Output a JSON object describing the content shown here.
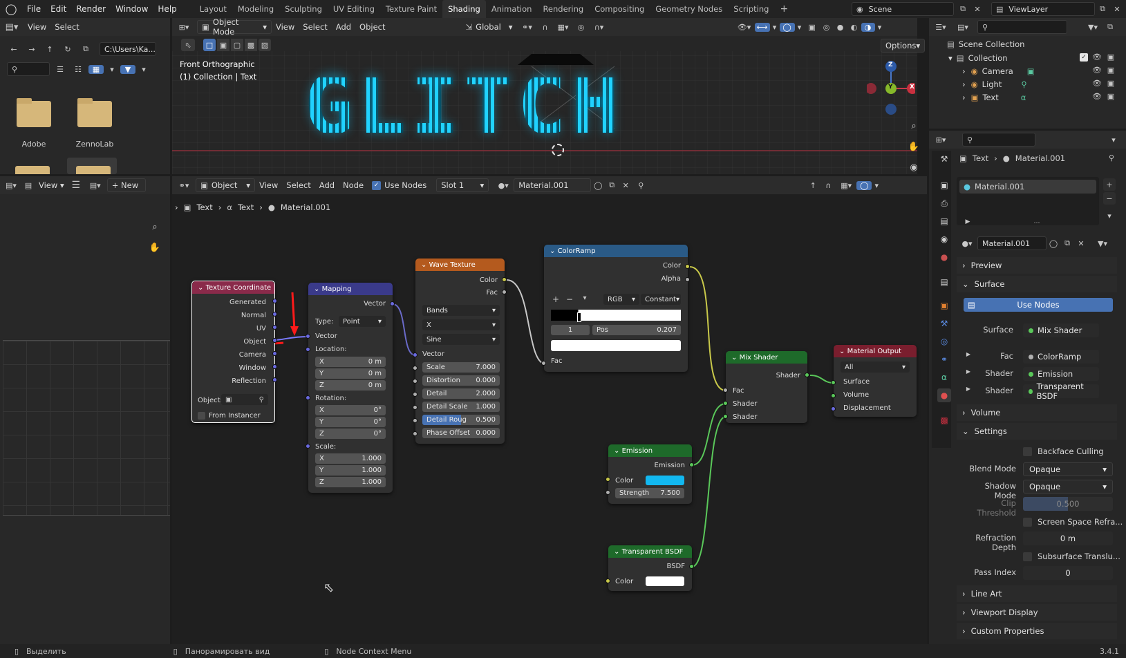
{
  "topbar": {
    "menus": [
      "File",
      "Edit",
      "Render",
      "Window",
      "Help"
    ],
    "workspaces": [
      "Layout",
      "Modeling",
      "Sculpting",
      "UV Editing",
      "Texture Paint",
      "Shading",
      "Animation",
      "Rendering",
      "Compositing",
      "Geometry Nodes",
      "Scripting"
    ],
    "active_workspace": "Shading",
    "add_tab": "+",
    "scene": "Scene",
    "view_layer": "ViewLayer"
  },
  "filebrowser": {
    "view": "View",
    "select": "Select",
    "path": "C:\\Users\\Ka...",
    "folders": [
      "Adobe",
      "ZennoLab"
    ]
  },
  "viewport": {
    "mode": "Object Mode",
    "view": "View",
    "select": "Select",
    "add": "Add",
    "object": "Object",
    "transform": "Global",
    "options": "Options",
    "info_line1": "Front Orthographic",
    "info_line2": "(1) Collection | Text",
    "neon_text": "GLITCH",
    "gizmo": {
      "z": "Z",
      "y": "Y",
      "x": "X"
    }
  },
  "image_editor": {
    "view": "View",
    "new": "New"
  },
  "node_editor": {
    "editor_type": "Object",
    "view": "View",
    "select": "Select",
    "add": "Add",
    "node": "Node",
    "use_nodes": "Use Nodes",
    "slot": "Slot 1",
    "material": "Material.001",
    "breadcrumb": [
      "Text",
      "Text",
      "Material.001"
    ]
  },
  "nodes": {
    "texcoord": {
      "title": "Texture Coordinate",
      "outputs": [
        "Generated",
        "Normal",
        "UV",
        "Object",
        "Camera",
        "Window",
        "Reflection"
      ],
      "object_label": "Object:",
      "from_instancer": "From Instancer"
    },
    "mapping": {
      "title": "Mapping",
      "vector_out": "Vector",
      "type_label": "Type:",
      "type_value": "Point",
      "vector_in": "Vector",
      "location": "Location:",
      "loc": [
        [
          "X",
          "0 m"
        ],
        [
          "Y",
          "0 m"
        ],
        [
          "Z",
          "0 m"
        ]
      ],
      "rotation": "Rotation:",
      "rot": [
        [
          "X",
          "0°"
        ],
        [
          "Y",
          "0°"
        ],
        [
          "Z",
          "0°"
        ]
      ],
      "scale": "Scale:",
      "scl": [
        [
          "X",
          "1.000"
        ],
        [
          "Y",
          "1.000"
        ],
        [
          "Z",
          "1.000"
        ]
      ]
    },
    "wave": {
      "title": "Wave Texture",
      "out_color": "Color",
      "out_fac": "Fac",
      "type": "Bands",
      "direction": "X",
      "profile": "Sine",
      "vector_in": "Vector",
      "fields": [
        [
          "Scale",
          "7.000"
        ],
        [
          "Distortion",
          "0.000"
        ],
        [
          "Detail",
          "2.000"
        ],
        [
          "Detail Scale",
          "1.000"
        ],
        [
          "Detail Roug",
          "0.500"
        ],
        [
          "Phase Offset",
          "0.000"
        ]
      ]
    },
    "colorramp": {
      "title": "ColorRamp",
      "out_color": "Color",
      "out_alpha": "Alpha",
      "mode": "RGB",
      "interp": "Constant",
      "index": "1",
      "pos_label": "Pos",
      "pos_value": "0.207",
      "fac_in": "Fac"
    },
    "mixshader": {
      "title": "Mix Shader",
      "out": "Shader",
      "inputs": [
        "Fac",
        "Shader",
        "Shader"
      ]
    },
    "matoutput": {
      "title": "Material Output",
      "target": "All",
      "inputs": [
        "Surface",
        "Volume",
        "Displacement"
      ]
    },
    "emission": {
      "title": "Emission",
      "out": "Emission",
      "color": "Color",
      "strength_label": "Strength",
      "strength_value": "7.500",
      "color_hex": "#12b8f0"
    },
    "transparent": {
      "title": "Transparent BSDF",
      "out": "BSDF",
      "color": "Color"
    }
  },
  "outliner": {
    "root": "Scene Collection",
    "collection": "Collection",
    "items": [
      "Camera",
      "Light",
      "Text"
    ]
  },
  "properties": {
    "breadcrumb_object": "Text",
    "breadcrumb_material": "Material.001",
    "slot_material": "Material.001",
    "datablock": "Material.001",
    "panels": {
      "preview": "Preview",
      "surface": "Surface",
      "volume": "Volume",
      "settings": "Settings",
      "line_art": "Line Art",
      "viewport_display": "Viewport Display",
      "custom_properties": "Custom Properties"
    },
    "use_nodes": "Use Nodes",
    "surface_label": "Surface",
    "surface_value": "Mix Shader",
    "fac_label": "Fac",
    "fac_value": "ColorRamp",
    "shader1_label": "Shader",
    "shader1_value": "Emission",
    "shader2_label": "Shader",
    "shader2_value": "Transparent BSDF",
    "backface_culling": "Backface Culling",
    "blend_mode_label": "Blend Mode",
    "blend_mode": "Opaque",
    "shadow_mode_label": "Shadow Mode",
    "shadow_mode": "Opaque",
    "clip_threshold_label": "Clip Threshold",
    "clip_threshold": "0.500",
    "ssr": "Screen Space Refra...",
    "refraction_depth_label": "Refraction Depth",
    "refraction_depth": "0 m",
    "subsurface": "Subsurface Translu...",
    "pass_index_label": "Pass Index",
    "pass_index": "0"
  },
  "statusbar": {
    "select": "Выделить",
    "pan": "Панорамировать вид",
    "context": "Node Context Menu",
    "version": "3.4.1"
  },
  "colors": {
    "accent": "#4772b3",
    "neon": "#14c8ff",
    "texcoord_header": "#8a2a4a",
    "mapping_header": "#3a3a8a",
    "wave_header": "#b45a1e",
    "colorramp_header": "#2a5a86",
    "shader_header": "#1e6a2a",
    "output_header": "#7a1e2e"
  }
}
